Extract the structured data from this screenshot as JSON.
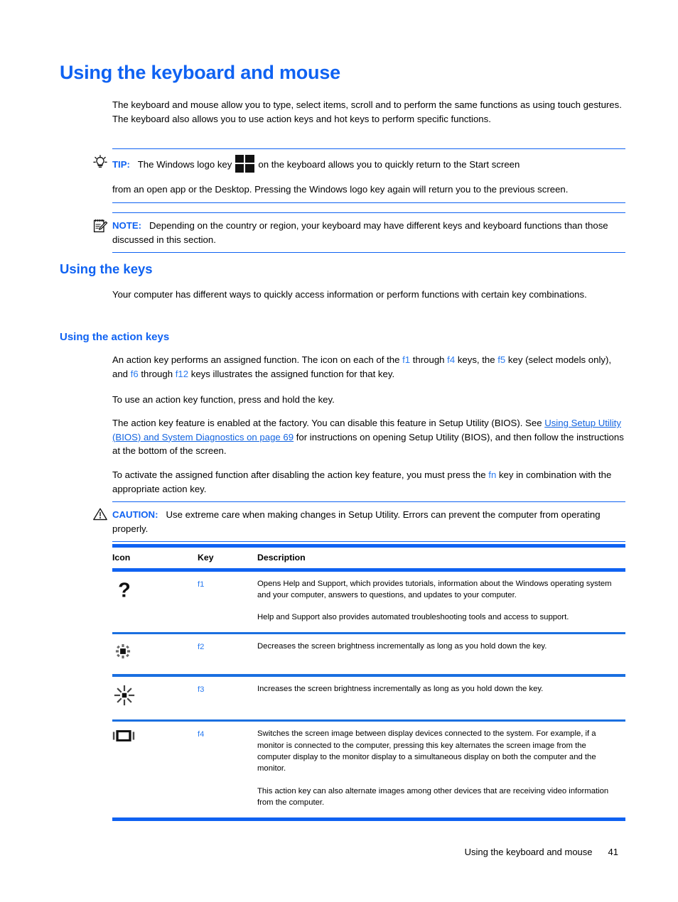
{
  "page": {
    "heading": "Using the keyboard and mouse",
    "intro": "The keyboard and mouse allow you to type, select items, scroll and to perform the same functions as using touch gestures. The keyboard also allows you to use action keys and hot keys to perform specific functions."
  },
  "tip": {
    "icon": "lightbulb-icon",
    "label": "TIP:",
    "text_before_logo": "The Windows logo key",
    "logo": "windows-logo-icon",
    "text_after_logo": "on the keyboard allows you to quickly return to the Start screen",
    "text_continued": "from an open app or the Desktop. Pressing the Windows logo key again will return you to the previous screen."
  },
  "note": {
    "icon": "notepad-pencil-icon",
    "label": "NOTE:",
    "text": "Depending on the country or region, your keyboard may have different keys and keyboard functions than those discussed in this section."
  },
  "using_keys": {
    "heading": "Using the keys",
    "text": "Your computer has different ways to quickly access information or perform functions with certain key combinations."
  },
  "action_keys": {
    "heading": "Using the action keys",
    "para1_a": "An action key performs an assigned function. The icon on each of the ",
    "para1_f1": "f1",
    "para1_b": " through ",
    "para1_f4": "f4",
    "para1_c": " keys, the ",
    "para1_f5": "f5",
    "para1_d": " key (select models only), and ",
    "para1_f6": "f6",
    "para1_e": " through ",
    "para1_f12": "f12",
    "para1_f": " keys illustrates the assigned function for that key.",
    "para2": "To use an action key function, press and hold the key.",
    "para3_a": "The action key feature is enabled at the factory. You can disable this feature in Setup Utility (BIOS). See ",
    "para3_link": "Using Setup Utility (BIOS) and System Diagnostics on page 69",
    "para3_b": " for instructions on opening Setup Utility (BIOS), and then follow the instructions at the bottom of the screen.",
    "para4_a": "To activate the assigned function after disabling the action key feature, you must press the ",
    "para4_fn": "fn",
    "para4_b": " key in combination with the appropriate action key."
  },
  "caution": {
    "icon": "warning-triangle-icon",
    "label": "CAUTION:",
    "text": "Use extreme care when making changes in Setup Utility. Errors can prevent the computer from operating properly."
  },
  "table": {
    "headers": {
      "icon": "Icon",
      "key": "Key",
      "description": "Description"
    },
    "rows": [
      {
        "icon": "question-mark-icon",
        "key": "f1",
        "description_1": "Opens Help and Support, which provides tutorials, information about the Windows operating system and your computer, answers to questions, and updates to your computer.",
        "description_2": "Help and Support also provides automated troubleshooting tools and access to support."
      },
      {
        "icon": "brightness-decrease-icon",
        "key": "f2",
        "description_1": "Decreases the screen brightness incrementally as long as you hold down the key.",
        "description_2": ""
      },
      {
        "icon": "brightness-increase-icon",
        "key": "f3",
        "description_1": "Increases the screen brightness incrementally as long as you hold down the key.",
        "description_2": ""
      },
      {
        "icon": "switch-display-icon",
        "key": "f4",
        "description_1": "Switches the screen image between display devices connected to the system. For example, if a monitor is connected to the computer, pressing this key alternates the screen image from the computer display to the monitor display to a simultaneous display on both the computer and the monitor.",
        "description_2": "This action key can also alternate images among other devices that are receiving video information from the computer."
      }
    ]
  },
  "footer": {
    "title": "Using the keyboard and mouse",
    "page_number": "41"
  },
  "colors": {
    "heading_blue": "#0f62f2",
    "link_blue": "#1364e0",
    "key_blue": "#2a7bf0",
    "rule_blue": "#0f62f2"
  }
}
